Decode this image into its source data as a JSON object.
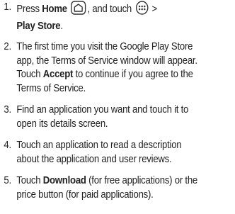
{
  "steps": [
    {
      "num": "1.",
      "l1_a": "Press ",
      "l1_home": "Home",
      "l1_b": ", and touch ",
      "l1_c": " >",
      "l2_store": "Play Store",
      "l2_end": ".",
      "home_icon": "home-icon",
      "apps_icon": "apps-grid-icon"
    },
    {
      "num": "2.",
      "l1": "The first time you visit the Google Play Store",
      "l2": "app, the Terms of Service window will appear.",
      "l3_a": "Touch ",
      "l3_accept": "Accept",
      "l3_b": " to continue if you agree to the",
      "l4": "Terms of Service."
    },
    {
      "num": "3.",
      "l1": "Find an application you want and touch it to",
      "l2": "open its details screen."
    },
    {
      "num": "4.",
      "l1": "Touch an application to read a description",
      "l2": "about the application and user reviews."
    },
    {
      "num": "5.",
      "l1_a": "Touch ",
      "l1_download": "Download",
      "l1_b": " (for free applications) or the",
      "l2": "price button (for paid applications)."
    }
  ]
}
